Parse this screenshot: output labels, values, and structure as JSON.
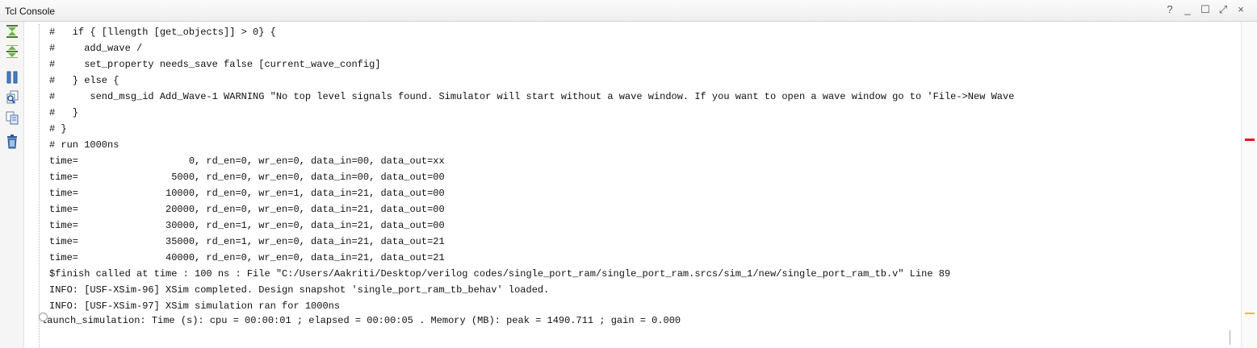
{
  "window": {
    "title": "Tcl Console",
    "controls": [
      "?",
      "_",
      "☐",
      "⤢",
      "×"
    ]
  },
  "toolbar": {
    "icons": [
      "collapse-all-icon",
      "expand-all-icon",
      "pause-output-icon",
      "find-icon",
      "copy-icon",
      "clear-console-icon"
    ]
  },
  "console": {
    "lines": [
      "#   if { [llength [get_objects]] > 0} {",
      "#     add_wave /",
      "#     set_property needs_save false [current_wave_config]",
      "#   } else {",
      "#      send_msg_id Add_Wave-1 WARNING \"No top level signals found. Simulator will start without a wave window. If you want to open a wave window go to 'File->New Wave",
      "#   }",
      "# }",
      "# run 1000ns",
      "time=                   0, rd_en=0, wr_en=0, data_in=00, data_out=xx",
      "time=                5000, rd_en=0, wr_en=0, data_in=00, data_out=00",
      "time=               10000, rd_en=0, wr_en=1, data_in=21, data_out=00",
      "time=               20000, rd_en=0, wr_en=0, data_in=21, data_out=00",
      "time=               30000, rd_en=1, wr_en=0, data_in=21, data_out=00",
      "time=               35000, rd_en=1, wr_en=0, data_in=21, data_out=21",
      "time=               40000, rd_en=0, wr_en=0, data_in=21, data_out=21",
      "$finish called at time : 100 ns : File \"C:/Users/Aakriti/Desktop/verilog codes/single_port_ram/single_port_ram.srcs/sim_1/new/single_port_ram_tb.v\" Line 89",
      "INFO: [USF-XSim-96] XSim completed. Design snapshot 'single_port_ram_tb_behav' loaded.",
      "INFO: [USF-XSim-97] XSim simulation ran for 1000ns",
      "launch_simulation: Time (s): cpu = 00:00:01 ; elapsed = 00:00:05 . Memory (MB): peak = 1490.711 ; gain = 0.000"
    ]
  },
  "overview_marks": {
    "error_color": "#e8131b",
    "warning_color": "#e5c21f"
  }
}
